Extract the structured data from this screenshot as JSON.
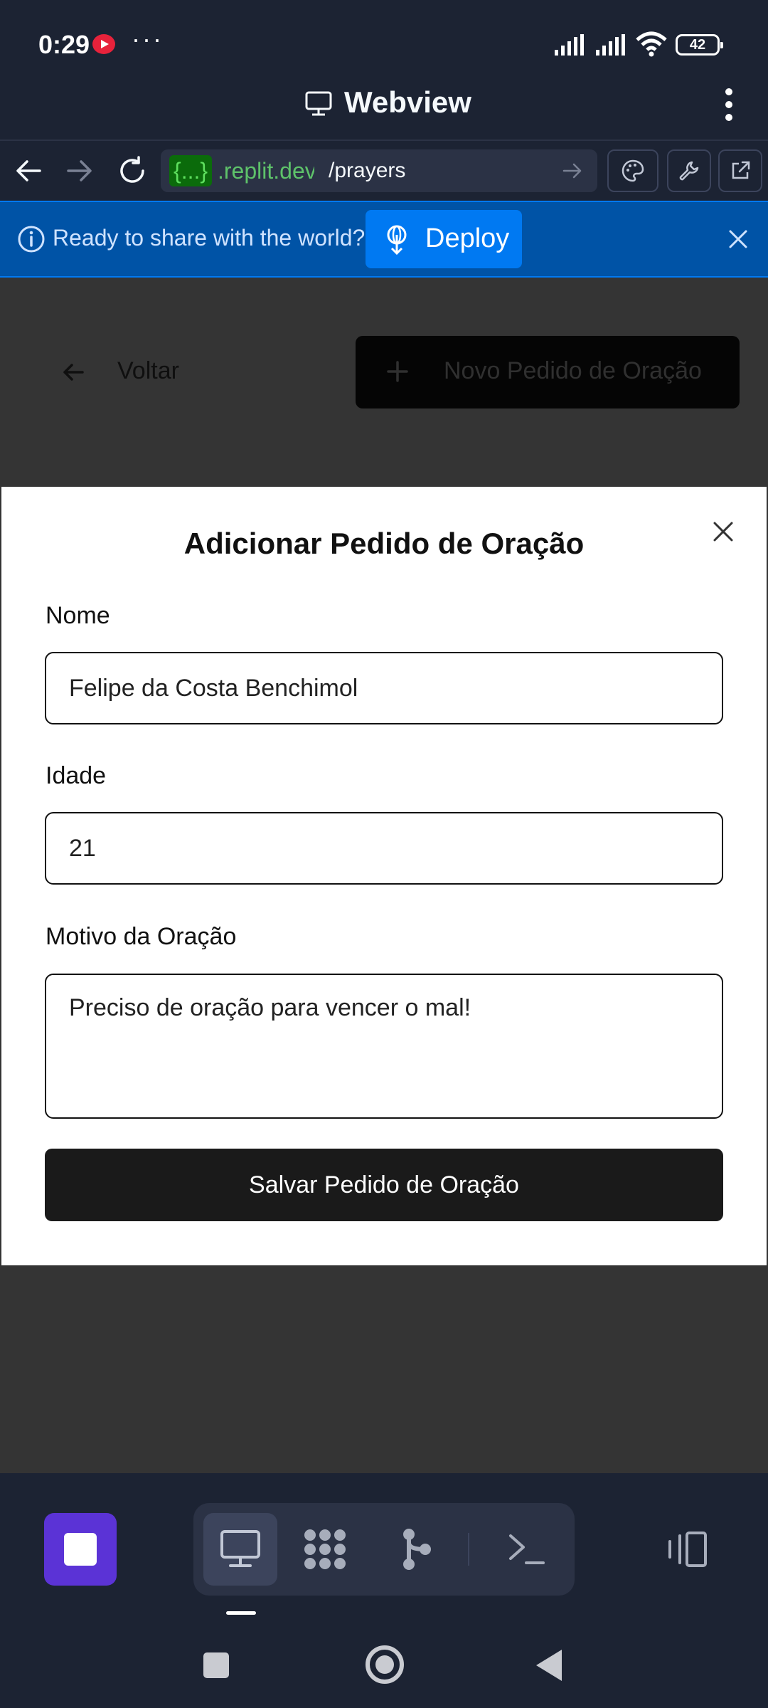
{
  "status_bar": {
    "time": "0:29",
    "more": "···",
    "battery": "42"
  },
  "webview": {
    "title": "Webview",
    "url": {
      "badge": "{...}",
      "domain": ".replit.dev",
      "path": "/prayers"
    }
  },
  "banner": {
    "text": "Ready to share with the world?",
    "deploy_label": "Deploy"
  },
  "app": {
    "back_label": "Voltar",
    "new_button_label": "Novo Pedido de Oração"
  },
  "dialog": {
    "title": "Adicionar Pedido de Oração",
    "name_label": "Nome",
    "name_value": "Felipe da Costa Benchimol",
    "age_label": "Idade",
    "age_value": "21",
    "reason_label": "Motivo da Oração",
    "reason_value": "Preciso de oração para vencer o mal!",
    "save_label": "Salvar Pedido de Oração"
  },
  "colors": {
    "ide_bg": "#1c2333",
    "banner_bg": "#0053a6",
    "deploy_button": "#0079f2",
    "stop_button": "#5b33d6",
    "overlay": "#343434"
  },
  "icons": [
    "monitor-icon",
    "kebab-menu-icon",
    "back-arrow-icon",
    "forward-arrow-icon",
    "reload-icon",
    "palette-icon",
    "wrench-icon",
    "external-link-icon",
    "info-icon",
    "deploy-icon",
    "close-icon",
    "plus-icon",
    "tools-icon",
    "git-icon",
    "shell-icon",
    "layout-icon"
  ]
}
